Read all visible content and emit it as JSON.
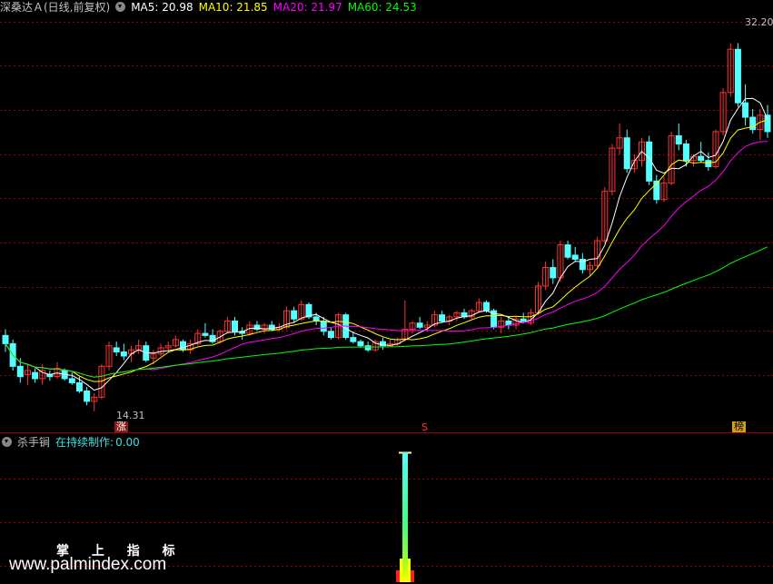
{
  "header": {
    "security": "深桑达Ａ(日线,前复权)",
    "ma": [
      {
        "label": "MA5:",
        "value": "20.98",
        "color": "#ffffff"
      },
      {
        "label": "MA10:",
        "value": "21.85",
        "color": "#ffff00"
      },
      {
        "label": "MA20:",
        "value": "21.97",
        "color": "#ff00ff"
      },
      {
        "label": "MA60:",
        "value": "24.53",
        "color": "#00ff00"
      }
    ]
  },
  "indicator": {
    "name": "杀手锏",
    "label": "在持续制作:",
    "value": "0.00"
  },
  "markers": {
    "low_label": "14.31",
    "high_label": "32.20",
    "tag_zhang": "涨",
    "tag_s": "S",
    "tag_bang": "榜"
  },
  "watermark": {
    "title": "掌 上 指 标",
    "url": "www.palmindex.com"
  },
  "colors": {
    "up": "#ff3232",
    "down": "#54ffff",
    "grid": "#a00000",
    "ma5": "#ffffff",
    "ma10": "#ffff00",
    "ma20": "#ff00ff",
    "ma60": "#00ff00"
  },
  "chart_data": {
    "type": "candlestick",
    "ylim": [
      14.0,
      33.5
    ],
    "low": 14.31,
    "high": 32.2,
    "candles_ohlc": [
      [
        18.0,
        18.3,
        17.2,
        17.6
      ],
      [
        17.6,
        17.8,
        16.3,
        16.5
      ],
      [
        16.5,
        16.9,
        15.7,
        16.0
      ],
      [
        16.1,
        16.6,
        15.6,
        16.3
      ],
      [
        16.2,
        16.4,
        15.7,
        15.9
      ],
      [
        15.9,
        16.6,
        15.6,
        16.3
      ],
      [
        16.1,
        16.3,
        15.8,
        16.0
      ],
      [
        16.0,
        16.7,
        15.9,
        16.4
      ],
      [
        16.3,
        16.4,
        15.8,
        15.9
      ],
      [
        15.9,
        16.2,
        15.6,
        15.7
      ],
      [
        15.7,
        16.0,
        15.2,
        15.3
      ],
      [
        15.3,
        15.5,
        14.6,
        14.8
      ],
      [
        14.8,
        15.2,
        14.31,
        15.0
      ],
      [
        15.0,
        16.6,
        14.9,
        16.5
      ],
      [
        16.5,
        17.7,
        16.3,
        17.5
      ],
      [
        17.4,
        17.7,
        17.0,
        17.2
      ],
      [
        17.2,
        17.6,
        16.8,
        17.0
      ],
      [
        17.1,
        17.5,
        16.7,
        17.3
      ],
      [
        17.3,
        17.8,
        17.1,
        17.5
      ],
      [
        17.5,
        17.7,
        16.7,
        16.8
      ],
      [
        16.9,
        17.3,
        16.6,
        17.1
      ],
      [
        17.1,
        17.6,
        17.0,
        17.4
      ],
      [
        17.4,
        17.7,
        17.2,
        17.5
      ],
      [
        17.5,
        18.0,
        17.4,
        17.8
      ],
      [
        17.7,
        17.8,
        17.2,
        17.3
      ],
      [
        17.3,
        17.8,
        17.1,
        17.6
      ],
      [
        17.6,
        18.3,
        17.5,
        18.1
      ],
      [
        18.1,
        18.6,
        17.9,
        18.0
      ],
      [
        18.0,
        18.3,
        17.6,
        17.7
      ],
      [
        17.7,
        18.3,
        17.6,
        18.2
      ],
      [
        18.2,
        18.9,
        18.1,
        18.7
      ],
      [
        18.7,
        18.9,
        18.0,
        18.2
      ],
      [
        18.2,
        18.4,
        17.8,
        18.1
      ],
      [
        18.1,
        18.7,
        18.0,
        18.5
      ],
      [
        18.5,
        18.7,
        18.2,
        18.3
      ],
      [
        18.3,
        18.6,
        18.1,
        18.5
      ],
      [
        18.5,
        18.7,
        18.2,
        18.3
      ],
      [
        18.3,
        18.6,
        18.2,
        18.4
      ],
      [
        18.4,
        19.4,
        18.3,
        19.2
      ],
      [
        19.2,
        19.4,
        18.6,
        18.8
      ],
      [
        18.8,
        19.7,
        18.7,
        19.5
      ],
      [
        19.5,
        19.6,
        18.8,
        18.9
      ],
      [
        18.9,
        19.1,
        18.5,
        18.7
      ],
      [
        18.7,
        18.9,
        18.0,
        18.2
      ],
      [
        18.2,
        18.4,
        17.8,
        17.9
      ],
      [
        17.9,
        19.1,
        17.8,
        19.0
      ],
      [
        19.0,
        19.1,
        17.8,
        17.9
      ],
      [
        17.9,
        18.2,
        17.6,
        17.7
      ],
      [
        17.7,
        17.8,
        17.4,
        17.5
      ],
      [
        17.5,
        17.7,
        17.2,
        17.3
      ],
      [
        17.3,
        17.8,
        17.2,
        17.7
      ],
      [
        17.7,
        17.9,
        17.3,
        17.5
      ],
      [
        17.5,
        17.8,
        17.5,
        17.6
      ],
      [
        17.6,
        17.9,
        17.5,
        17.8
      ],
      [
        17.8,
        19.7,
        17.7,
        18.3
      ],
      [
        18.3,
        18.7,
        18.1,
        18.6
      ],
      [
        18.6,
        18.9,
        18.3,
        18.4
      ],
      [
        18.4,
        18.7,
        18.2,
        18.5
      ],
      [
        18.5,
        19.2,
        18.4,
        19.0
      ],
      [
        19.0,
        19.2,
        18.6,
        18.7
      ],
      [
        18.7,
        19.0,
        18.5,
        18.9
      ],
      [
        18.9,
        19.2,
        18.7,
        19.1
      ],
      [
        19.1,
        19.3,
        18.8,
        18.9
      ],
      [
        18.9,
        19.3,
        18.8,
        19.2
      ],
      [
        19.2,
        19.8,
        19.1,
        19.6
      ],
      [
        19.6,
        19.7,
        19.1,
        19.2
      ],
      [
        19.2,
        19.3,
        18.3,
        18.4
      ],
      [
        18.4,
        18.9,
        18.1,
        18.7
      ],
      [
        18.7,
        18.9,
        18.3,
        18.5
      ],
      [
        18.5,
        18.9,
        18.3,
        18.8
      ],
      [
        18.8,
        19.1,
        18.6,
        18.7
      ],
      [
        18.6,
        19.3,
        18.5,
        19.1
      ],
      [
        19.1,
        20.6,
        19.0,
        20.4
      ],
      [
        20.4,
        21.6,
        20.2,
        21.3
      ],
      [
        21.3,
        21.7,
        20.5,
        20.8
      ],
      [
        20.8,
        22.6,
        20.6,
        22.4
      ],
      [
        22.4,
        22.6,
        21.7,
        21.8
      ],
      [
        21.9,
        22.3,
        21.6,
        21.7
      ],
      [
        21.7,
        22.0,
        21.0,
        21.2
      ],
      [
        21.2,
        21.6,
        20.9,
        21.4
      ],
      [
        21.4,
        22.8,
        21.3,
        22.6
      ],
      [
        22.6,
        25.2,
        22.5,
        25.0
      ],
      [
        25.0,
        27.3,
        24.8,
        27.1
      ],
      [
        27.1,
        28.3,
        26.8,
        27.6
      ],
      [
        27.6,
        28.0,
        25.9,
        26.1
      ],
      [
        26.1,
        26.8,
        25.9,
        26.5
      ],
      [
        26.5,
        27.6,
        26.2,
        27.4
      ],
      [
        27.4,
        27.7,
        25.3,
        25.5
      ],
      [
        25.5,
        25.8,
        24.4,
        24.6
      ],
      [
        24.6,
        25.7,
        24.5,
        25.4
      ],
      [
        25.4,
        27.9,
        25.3,
        27.7
      ],
      [
        27.7,
        28.3,
        27.0,
        27.3
      ],
      [
        27.3,
        27.5,
        26.2,
        26.5
      ],
      [
        26.5,
        26.8,
        26.2,
        26.7
      ],
      [
        26.7,
        27.4,
        26.4,
        26.5
      ],
      [
        26.5,
        26.9,
        26.0,
        26.2
      ],
      [
        26.2,
        28.0,
        26.1,
        27.9
      ],
      [
        27.9,
        30.0,
        27.7,
        29.8
      ],
      [
        29.8,
        32.2,
        29.6,
        31.9
      ],
      [
        31.9,
        32.2,
        29.1,
        29.3
      ],
      [
        29.3,
        30.2,
        28.2,
        28.6
      ],
      [
        28.6,
        29.0,
        27.8,
        28.0
      ],
      [
        28.0,
        29.0,
        27.5,
        28.7
      ],
      [
        28.7,
        29.2,
        27.6,
        27.9
      ]
    ],
    "indicator_bars": [
      {
        "x": 446,
        "value": 1.0
      }
    ]
  }
}
